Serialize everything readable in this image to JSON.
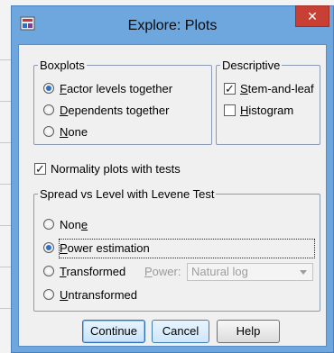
{
  "dialog": {
    "title": "Explore: Plots",
    "close_label": "✕"
  },
  "boxplots": {
    "legend": "Boxplots",
    "options": [
      {
        "pre": "",
        "key": "F",
        "post": "actor levels together",
        "selected": true
      },
      {
        "pre": "",
        "key": "D",
        "post": "ependents together",
        "selected": false
      },
      {
        "pre": "",
        "key": "N",
        "post": "one",
        "selected": false
      }
    ]
  },
  "descriptive": {
    "legend": "Descriptive",
    "stem_leaf": {
      "pre": "",
      "key": "S",
      "post": "tem-and-leaf",
      "checked": true
    },
    "histogram": {
      "pre": "",
      "key": "H",
      "post": "istogram",
      "checked": false
    }
  },
  "normality": {
    "pre": "",
    "key": "",
    "post": "Normality plots with tests",
    "checked": true
  },
  "spread": {
    "legend": "Spread vs Level with Levene Test",
    "options": [
      {
        "pre": "Non",
        "key": "e",
        "post": "",
        "selected": false
      },
      {
        "pre": "",
        "key": "P",
        "post": "ower estimation",
        "selected": true
      },
      {
        "pre": "",
        "key": "T",
        "post": "ransformed",
        "selected": false
      },
      {
        "pre": "",
        "key": "U",
        "post": "ntransformed",
        "selected": false
      }
    ],
    "power_label_pre": "",
    "power_label_key": "P",
    "power_label_post": "ower:",
    "power_value": "Natural log"
  },
  "buttons": {
    "continue": "Continue",
    "cancel": "Cancel",
    "help": "Help"
  },
  "colors": {
    "title_bar": "#6ea6de",
    "close_button": "#c74033",
    "accent": "#2e6fc8"
  }
}
